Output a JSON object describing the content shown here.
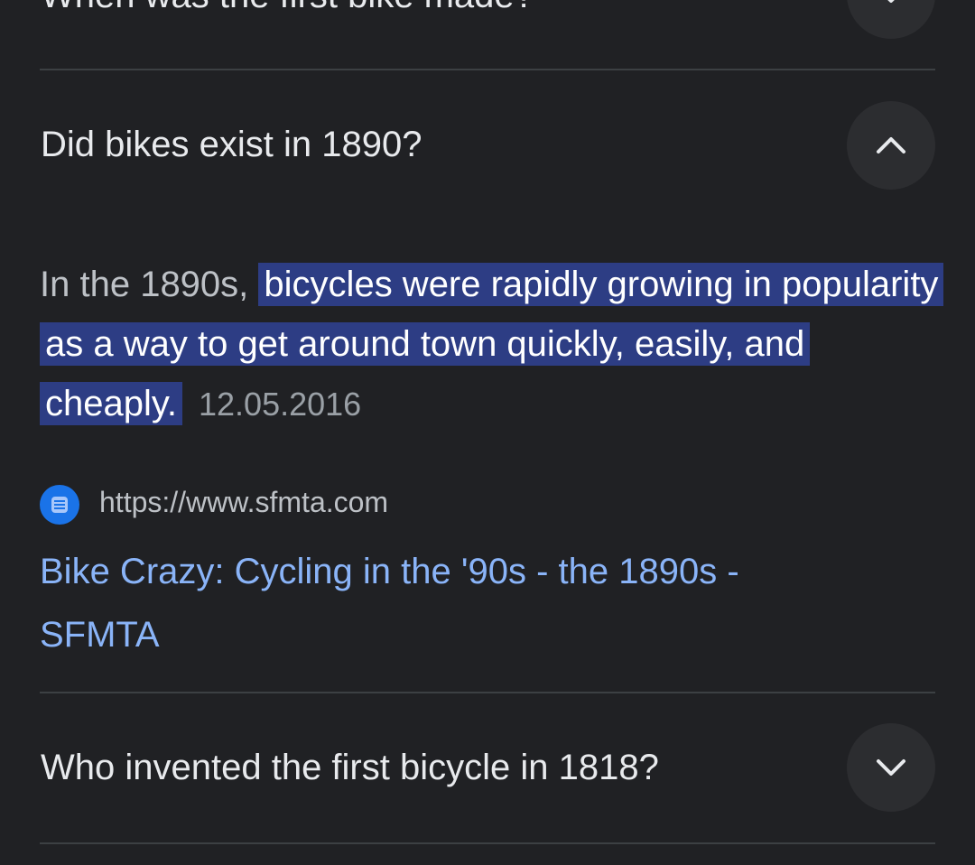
{
  "faq": {
    "items": [
      {
        "question": "When was the first bike made?",
        "expanded": false
      },
      {
        "question": "Did bikes exist in 1890?",
        "expanded": true
      },
      {
        "question": "Who invented the first bicycle in 1818?",
        "expanded": false
      }
    ],
    "answer": {
      "prefix": "In the 1890s,",
      "highlighted": "bicycles were rapidly growing in popularity as a way to get around town quickly, easily, and cheaply.",
      "date": "12.05.2016"
    },
    "source": {
      "favicon_icon": "sfmta-favicon-icon",
      "url": "https://www.sfmta.com",
      "title": "Bike Crazy: Cycling in the '90s - the 1890s - SFMTA"
    }
  },
  "colors": {
    "background": "#202124",
    "highlight": "#2d3d84",
    "link": "#8ab4f8",
    "divider": "#3c4043",
    "button": "#2c2d30"
  }
}
